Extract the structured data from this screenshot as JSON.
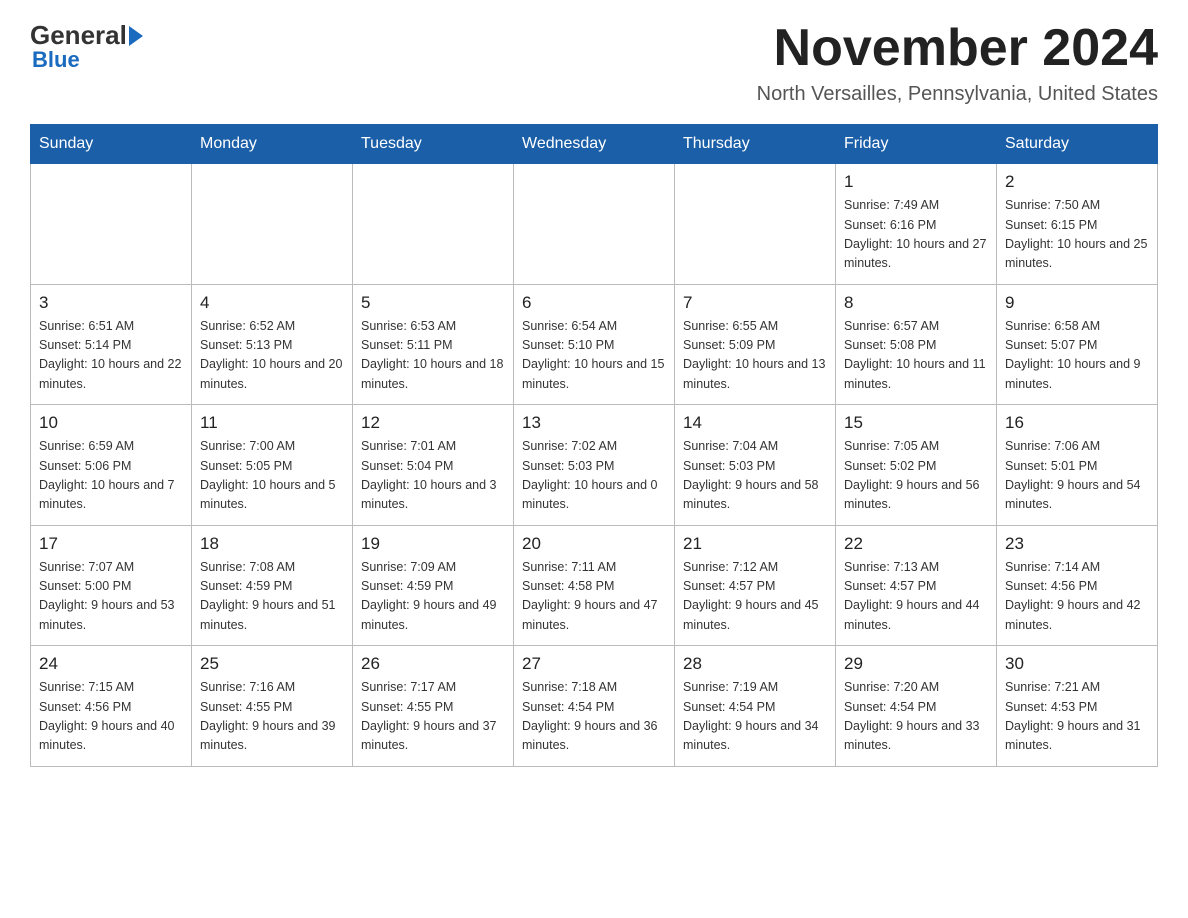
{
  "logo": {
    "text_general": "General",
    "text_blue": "Blue"
  },
  "header": {
    "title": "November 2024",
    "subtitle": "North Versailles, Pennsylvania, United States"
  },
  "days_of_week": [
    "Sunday",
    "Monday",
    "Tuesday",
    "Wednesday",
    "Thursday",
    "Friday",
    "Saturday"
  ],
  "weeks": [
    [
      {
        "day": "",
        "info": ""
      },
      {
        "day": "",
        "info": ""
      },
      {
        "day": "",
        "info": ""
      },
      {
        "day": "",
        "info": ""
      },
      {
        "day": "",
        "info": ""
      },
      {
        "day": "1",
        "info": "Sunrise: 7:49 AM\nSunset: 6:16 PM\nDaylight: 10 hours and 27 minutes."
      },
      {
        "day": "2",
        "info": "Sunrise: 7:50 AM\nSunset: 6:15 PM\nDaylight: 10 hours and 25 minutes."
      }
    ],
    [
      {
        "day": "3",
        "info": "Sunrise: 6:51 AM\nSunset: 5:14 PM\nDaylight: 10 hours and 22 minutes."
      },
      {
        "day": "4",
        "info": "Sunrise: 6:52 AM\nSunset: 5:13 PM\nDaylight: 10 hours and 20 minutes."
      },
      {
        "day": "5",
        "info": "Sunrise: 6:53 AM\nSunset: 5:11 PM\nDaylight: 10 hours and 18 minutes."
      },
      {
        "day": "6",
        "info": "Sunrise: 6:54 AM\nSunset: 5:10 PM\nDaylight: 10 hours and 15 minutes."
      },
      {
        "day": "7",
        "info": "Sunrise: 6:55 AM\nSunset: 5:09 PM\nDaylight: 10 hours and 13 minutes."
      },
      {
        "day": "8",
        "info": "Sunrise: 6:57 AM\nSunset: 5:08 PM\nDaylight: 10 hours and 11 minutes."
      },
      {
        "day": "9",
        "info": "Sunrise: 6:58 AM\nSunset: 5:07 PM\nDaylight: 10 hours and 9 minutes."
      }
    ],
    [
      {
        "day": "10",
        "info": "Sunrise: 6:59 AM\nSunset: 5:06 PM\nDaylight: 10 hours and 7 minutes."
      },
      {
        "day": "11",
        "info": "Sunrise: 7:00 AM\nSunset: 5:05 PM\nDaylight: 10 hours and 5 minutes."
      },
      {
        "day": "12",
        "info": "Sunrise: 7:01 AM\nSunset: 5:04 PM\nDaylight: 10 hours and 3 minutes."
      },
      {
        "day": "13",
        "info": "Sunrise: 7:02 AM\nSunset: 5:03 PM\nDaylight: 10 hours and 0 minutes."
      },
      {
        "day": "14",
        "info": "Sunrise: 7:04 AM\nSunset: 5:03 PM\nDaylight: 9 hours and 58 minutes."
      },
      {
        "day": "15",
        "info": "Sunrise: 7:05 AM\nSunset: 5:02 PM\nDaylight: 9 hours and 56 minutes."
      },
      {
        "day": "16",
        "info": "Sunrise: 7:06 AM\nSunset: 5:01 PM\nDaylight: 9 hours and 54 minutes."
      }
    ],
    [
      {
        "day": "17",
        "info": "Sunrise: 7:07 AM\nSunset: 5:00 PM\nDaylight: 9 hours and 53 minutes."
      },
      {
        "day": "18",
        "info": "Sunrise: 7:08 AM\nSunset: 4:59 PM\nDaylight: 9 hours and 51 minutes."
      },
      {
        "day": "19",
        "info": "Sunrise: 7:09 AM\nSunset: 4:59 PM\nDaylight: 9 hours and 49 minutes."
      },
      {
        "day": "20",
        "info": "Sunrise: 7:11 AM\nSunset: 4:58 PM\nDaylight: 9 hours and 47 minutes."
      },
      {
        "day": "21",
        "info": "Sunrise: 7:12 AM\nSunset: 4:57 PM\nDaylight: 9 hours and 45 minutes."
      },
      {
        "day": "22",
        "info": "Sunrise: 7:13 AM\nSunset: 4:57 PM\nDaylight: 9 hours and 44 minutes."
      },
      {
        "day": "23",
        "info": "Sunrise: 7:14 AM\nSunset: 4:56 PM\nDaylight: 9 hours and 42 minutes."
      }
    ],
    [
      {
        "day": "24",
        "info": "Sunrise: 7:15 AM\nSunset: 4:56 PM\nDaylight: 9 hours and 40 minutes."
      },
      {
        "day": "25",
        "info": "Sunrise: 7:16 AM\nSunset: 4:55 PM\nDaylight: 9 hours and 39 minutes."
      },
      {
        "day": "26",
        "info": "Sunrise: 7:17 AM\nSunset: 4:55 PM\nDaylight: 9 hours and 37 minutes."
      },
      {
        "day": "27",
        "info": "Sunrise: 7:18 AM\nSunset: 4:54 PM\nDaylight: 9 hours and 36 minutes."
      },
      {
        "day": "28",
        "info": "Sunrise: 7:19 AM\nSunset: 4:54 PM\nDaylight: 9 hours and 34 minutes."
      },
      {
        "day": "29",
        "info": "Sunrise: 7:20 AM\nSunset: 4:54 PM\nDaylight: 9 hours and 33 minutes."
      },
      {
        "day": "30",
        "info": "Sunrise: 7:21 AM\nSunset: 4:53 PM\nDaylight: 9 hours and 31 minutes."
      }
    ]
  ]
}
